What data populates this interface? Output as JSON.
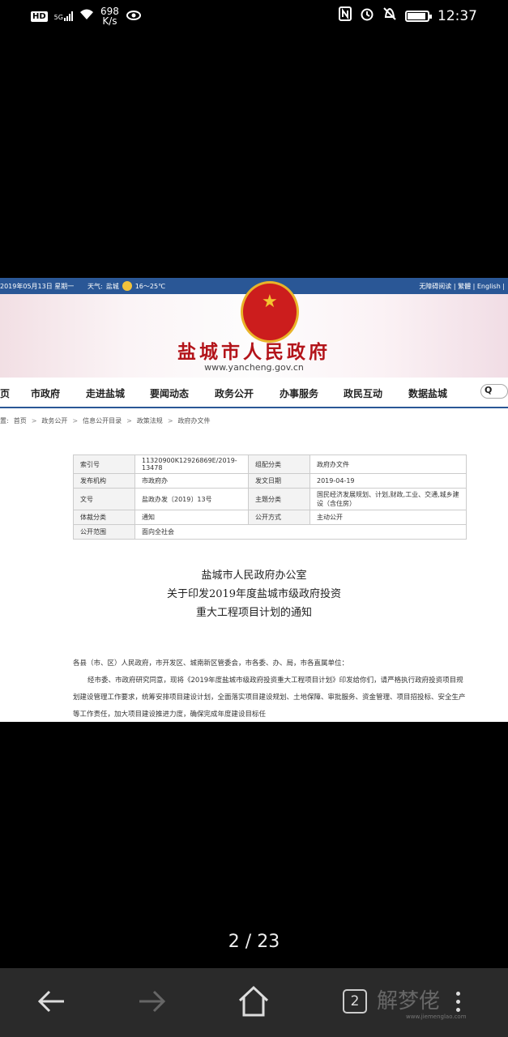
{
  "status_bar": {
    "hd": "HD",
    "signal_label": "5G",
    "net_speed_value": "698",
    "net_speed_unit": "K/s",
    "time": "12:37",
    "battery_level": 0.92,
    "icons": [
      "signal-icon",
      "wifi-icon",
      "eye-icon",
      "nfc-icon",
      "alarm-icon",
      "mute-icon",
      "battery-icon"
    ]
  },
  "site": {
    "topbar": {
      "date": "2019年05月13日 星期一",
      "weather_label": "天气:",
      "city": "盐城",
      "temp": "16～25℃",
      "right_links": "无障碍阅读 | 繁體 | English |"
    },
    "title": "盐城市人民政府",
    "url": "www.yancheng.gov.cn",
    "nav": [
      "页",
      "市政府",
      "走进盐城",
      "要闻动态",
      "政务公开",
      "办事服务",
      "政民互动",
      "数据盐城"
    ],
    "search_label": "Q",
    "breadcrumb": [
      "置:",
      "首页",
      "政务公开",
      "信息公开目录",
      "政策法规",
      "政府办文件"
    ],
    "breadcrumb_sep": ">",
    "info_rows": [
      [
        "索引号",
        "11320900K12926869E/2019-13478",
        "组配分类",
        "政府办文件"
      ],
      [
        "发布机构",
        "市政府办",
        "发文日期",
        "2019-04-19"
      ],
      [
        "文号",
        "盐政办发〔2019〕13号",
        "主题分类",
        "国民经济发展规划、计划,财政,工业、交通,城乡建设（含住房）"
      ],
      [
        "体裁分类",
        "通知",
        "公开方式",
        "主动公开"
      ],
      [
        "公开范围",
        "面向全社会",
        "",
        ""
      ]
    ],
    "doc_title": [
      "盐城市人民政府办公室",
      "关于印发2019年度盐城市级政府投资",
      "重大工程项目计划的通知"
    ],
    "body": [
      "各县（市、区）人民政府，市开发区、城南新区管委会，市各委、办、局，市各直属单位：",
      "经市委、市政府研究同意，现将《2019年度盐城市级政府投资重大工程项目计划》印发给你们，请严格执行政府投资项目规划建设管理工作要求，统筹安排项目建设计划，全面落实项目建设规划、土地保障、审批服务、资金管理、项目招投标、安全生产等工作责任，加大项目建设推进力度，确保完成年度建设目标任"
    ]
  },
  "viewer": {
    "page_counter": "2 / 23"
  },
  "bottom_nav": {
    "tabs_count": "2",
    "watermark": "解梦佬",
    "watermark_url": "www.jiemenglao.com"
  }
}
